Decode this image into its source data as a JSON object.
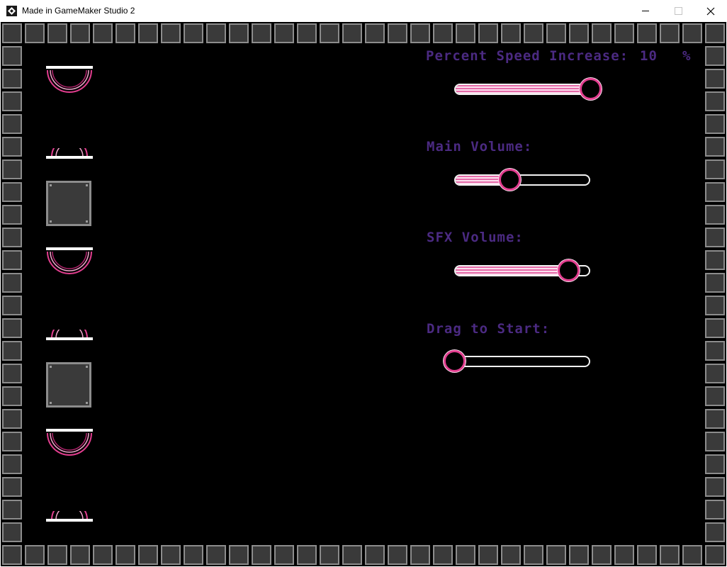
{
  "window": {
    "title": "Made in GameMaker Studio 2",
    "app_icon": "gamemaker-icon",
    "controls": [
      "minimize-icon",
      "maximize-icon",
      "close-icon"
    ]
  },
  "colors": {
    "label_purple": "#4b2a82",
    "accent_pink": "#e23e8f",
    "brick_fill": "#3a3a3a",
    "brick_border": "#8c8c8c",
    "background": "#000000"
  },
  "settings": {
    "speed": {
      "label": "Percent Speed Increase:",
      "value": "10",
      "unit": "%",
      "level": 1.0
    },
    "main_volume": {
      "label": "Main Volume:",
      "level": 0.41
    },
    "sfx_volume": {
      "label": "SFX Volume:",
      "level": 0.84
    },
    "start": {
      "label": "Drag to Start:",
      "level": 0.0
    }
  },
  "sprites": [
    "dish-full",
    "dish-half",
    "crate",
    "dish-full",
    "dish-half",
    "crate",
    "dish-full",
    "dish-half"
  ]
}
